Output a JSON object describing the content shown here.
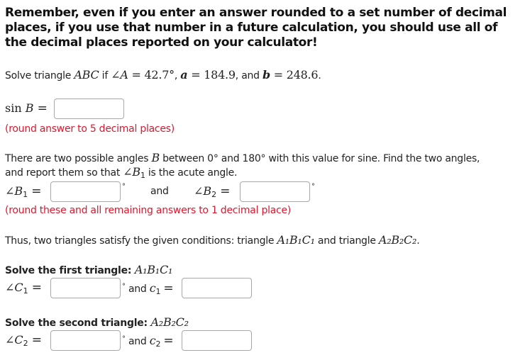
{
  "warning": {
    "line1": "Remember, even if you enter an answer rounded to a set number of decimal",
    "line2": "places, if you use that number in a future calculation, you should use all of",
    "line3": "the decimal places reported on your calculator!"
  },
  "problem": {
    "prefix": "Solve triangle ",
    "triangle": "ABC",
    "if": " if ",
    "angle_sym": "∠",
    "angle_var": "A",
    "eq": " = ",
    "angle_value": "42.7°",
    "sep1": ", ",
    "a_var": "a",
    "a_value": "184.9",
    "and": ", and ",
    "b_var": "b",
    "b_value": "248.6",
    "end": "."
  },
  "sinB": {
    "label_fn": "sin",
    "label_var": "B",
    "label_eq": "=",
    "value": "",
    "hint": "(round answer to 5 decimal places)"
  },
  "angles_prompt": {
    "line1_a": "There are two possible angles ",
    "line1_var": "B",
    "line1_b": " between 0° and 180° with this value for sine. Find the two angles,",
    "line2_a": "and report them so that ",
    "line2_angle": "∠B",
    "line2_sub": "1",
    "line2_b": " is the acute angle."
  },
  "B_inputs": {
    "b1_label": "∠B",
    "b1_sub": "1",
    "eq": "=",
    "b1_value": "",
    "degree": "°",
    "and": "and",
    "b2_label": "∠B",
    "b2_sub": "2",
    "b2_value": "",
    "hint": "(round these and all remaining answers to 1 decimal place)"
  },
  "thus": {
    "text_a": "Thus, two triangles satisfy the given conditions: triangle ",
    "t1": "A₁B₁C₁",
    "text_b": " and triangle ",
    "t2": "A₂B₂C₂",
    "end": "."
  },
  "first_triangle": {
    "heading": "Solve the first triangle: ",
    "heading_math": "A₁B₁C₁",
    "angle_label": "∠C",
    "angle_sub": "1",
    "eq": "=",
    "angle_value": "",
    "degree": "°",
    "and": " and ",
    "side_label": "c",
    "side_sub": "1",
    "side_value": ""
  },
  "second_triangle": {
    "heading": "Solve the second triangle: ",
    "heading_math": "A₂B₂C₂",
    "angle_label": "∠C",
    "angle_sub": "2",
    "eq": "=",
    "angle_value": "",
    "degree": "°",
    "and": " and ",
    "side_label": "c",
    "side_sub": "2",
    "side_value": ""
  }
}
